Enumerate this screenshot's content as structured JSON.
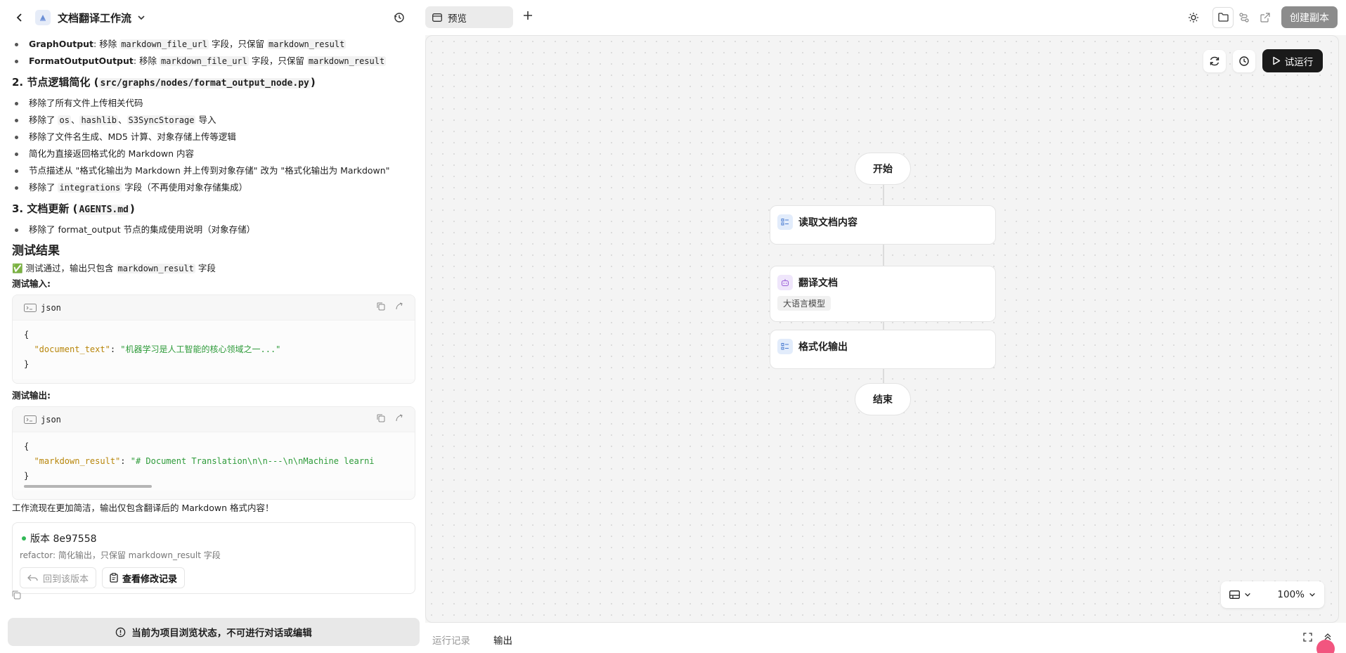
{
  "header": {
    "title": "文档翻译工作流"
  },
  "chat": {
    "top_bullets": [
      {
        "bold": "GraphOutput",
        "text1": ": 移除 ",
        "code1": "markdown_file_url",
        "text2": " 字段，只保留 ",
        "code2": "markdown_result"
      },
      {
        "bold": "FormatOutputOutput",
        "text1": ": 移除 ",
        "code1": "markdown_file_url",
        "text2": " 字段，只保留 ",
        "code2": "markdown_result"
      }
    ],
    "section2_title": "2. 节点逻辑简化 (",
    "section2_code": "src/graphs/nodes/format_output_node.py",
    "section2_close": ")",
    "section2_items": {
      "i1": "移除了所有文件上传相关代码",
      "i2_a": "移除了 ",
      "i2_c1": "os",
      "i2_b": "、",
      "i2_c2": "hashlib",
      "i2_d": "、",
      "i2_c3": "S3SyncStorage",
      "i2_e": " 导入",
      "i3": "移除了文件名生成、MD5 计算、对象存储上传等逻辑",
      "i4": "简化为直接返回格式化的 Markdown 内容",
      "i5": "节点描述从 \"格式化输出为 Markdown 并上传到对象存储\" 改为 \"格式化输出为 Markdown\"",
      "i6_a": "移除了 ",
      "i6_code": "integrations",
      "i6_b": " 字段（不再使用对象存储集成）"
    },
    "section3_title": "3. 文档更新 (",
    "section3_code": "AGENTS.md",
    "section3_close": ")",
    "section3_item": "移除了 format_output 节点的集成使用说明（对象存储）",
    "result_heading": "测试结果",
    "result_check": "✅",
    "result_text_a": " 测试通过，输出只包含 ",
    "result_code": "markdown_result",
    "result_text_b": " 字段",
    "test_input_label": "测试输入:",
    "test_output_label": "测试输出:",
    "code_lang": "json",
    "input_key": "\"document_text\"",
    "input_value": "\"机器学习是人工智能的核心领域之一...\"",
    "output_key": "\"markdown_result\"",
    "output_value": "\"# Document Translation\\n\\n---\\n\\nMachine learni",
    "brace_open": "{",
    "brace_close": "}",
    "colon": ": ",
    "summary": "工作流现在更加简洁，输出仅包含翻译后的 Markdown 格式内容！"
  },
  "version": {
    "title": "版本 8e97558",
    "message": "refactor: 简化输出，只保留 markdown_result 字段",
    "revert_label": "回到该版本",
    "view_label": "查看修改记录"
  },
  "status_bar": "当前为项目浏览状态，不可进行对话或编辑",
  "tabs": {
    "preview": "预览"
  },
  "toolbar": {
    "create_copy": "创建副本",
    "run": "试运行"
  },
  "flow": {
    "start": "开始",
    "end": "结束",
    "nodes": [
      {
        "label": "读取文档内容",
        "icon": "list-icon"
      },
      {
        "label": "翻译文档",
        "icon": "robot-icon",
        "tag": "大语言模型"
      },
      {
        "label": "格式化输出",
        "icon": "list-icon"
      }
    ]
  },
  "zoom": {
    "level": "100%"
  },
  "bottom": {
    "run_log": "运行记录",
    "output": "输出"
  },
  "colors": {
    "run_button": "#1a1a1a",
    "create_copy_button": "#8c8c8c",
    "version_dot": "#32b857",
    "json_key": "#b8860b",
    "json_string": "#2e9b3a"
  }
}
